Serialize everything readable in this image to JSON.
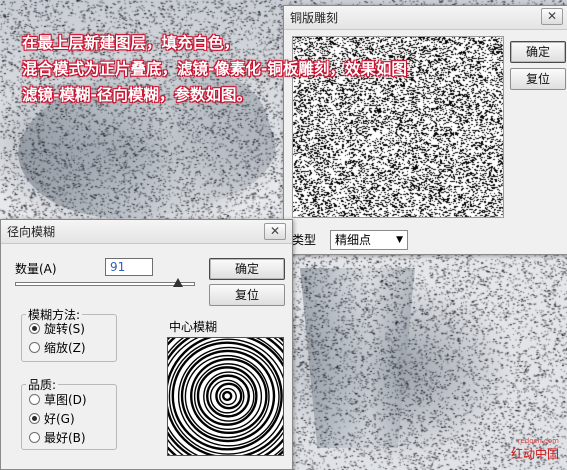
{
  "caption": {
    "line1": "在最上层新建图层，填充白色，",
    "line2": "混合模式为正片叠底，滤镜-像素化-铜板雕刻，效果如图",
    "line3": "滤镜-模糊-径向模糊，参数如图。"
  },
  "mosaic_dialog": {
    "title": "铜版雕刻",
    "close_glyph": "✕",
    "ok_label": "确定",
    "reset_label": "复位",
    "type_label": "类型",
    "type_value": "精细点",
    "dropdown_glyph": "▼"
  },
  "radial_dialog": {
    "title": "径向模糊",
    "close_glyph": "✕",
    "amount_label": "数量(A)",
    "amount_value": "91",
    "amount_max": 100,
    "ok_label": "确定",
    "reset_label": "复位",
    "method_legend": "模糊方法:",
    "method_options": [
      {
        "label": "旋转(S)",
        "selected": true
      },
      {
        "label": "缩放(Z)",
        "selected": false
      }
    ],
    "quality_legend": "品质:",
    "quality_options": [
      {
        "label": "草图(D)",
        "selected": false
      },
      {
        "label": "好(G)",
        "selected": true
      },
      {
        "label": "最好(B)",
        "selected": false
      }
    ],
    "center_label": "中心模糊"
  },
  "watermark": {
    "url": "redocn.com",
    "name": "红动中国"
  },
  "colors": {
    "caption_red": "#c8102e",
    "dialog_bg": "#f0f0f0",
    "amount_text": "#3060c0"
  }
}
